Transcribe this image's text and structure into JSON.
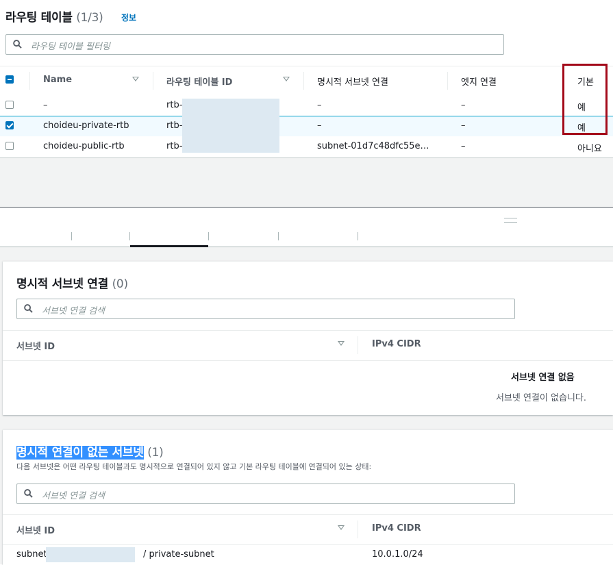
{
  "route_tables": {
    "title": "라우팅 테이블",
    "count": "(1/3)",
    "info_link": "정보",
    "filter_placeholder": "라우팅 테이블 필터링",
    "columns": [
      "Name",
      "라우팅 테이블 ID",
      "명시적 서브넷 연결",
      "엣지 연결",
      "기본"
    ],
    "rows": [
      {
        "name": "–",
        "id": "rtb-",
        "subnet": "–",
        "edge": "–",
        "main": "예",
        "selected": false
      },
      {
        "name": "choideu-private-rtb",
        "id": "rtb-",
        "subnet": "–",
        "edge": "–",
        "main": "예",
        "selected": true
      },
      {
        "name": "choideu-public-rtb",
        "id": "rtb-",
        "subnet": "subnet-01d7c48dfc55e…",
        "edge": "–",
        "main": "아니요",
        "selected": false
      }
    ]
  },
  "explicit_panel": {
    "title": "명시적 서브넷 연결",
    "count": "(0)",
    "search_placeholder": "서브넷 연결 검색",
    "col_subnet": "서브넷 ID",
    "col_cidr": "IPv4 CIDR",
    "empty_title": "서브넷 연결 없음",
    "empty_desc": "서브넷 연결이 없습니다."
  },
  "implicit_panel": {
    "title": "명시적 연결이 없는 서브넷",
    "count": "(1)",
    "description": "다음 서브넷은 어떤 라우팅 테이블과도 명시적으로 연결되어 있지 않고 기본 라우팅 테이블에 연결되어 있는 상태:",
    "search_placeholder": "서브넷 연결 검색",
    "col_subnet": "서브넷 ID",
    "col_cidr": "IPv4 CIDR",
    "row": {
      "subnet_prefix": "subnet",
      "subnet_suffix": "/ private-subnet",
      "cidr": "10.0.1.0/24"
    }
  },
  "colors": {
    "link": "#0073bb",
    "highlight_box": "#a30a1a",
    "selection": "#3390ff"
  }
}
